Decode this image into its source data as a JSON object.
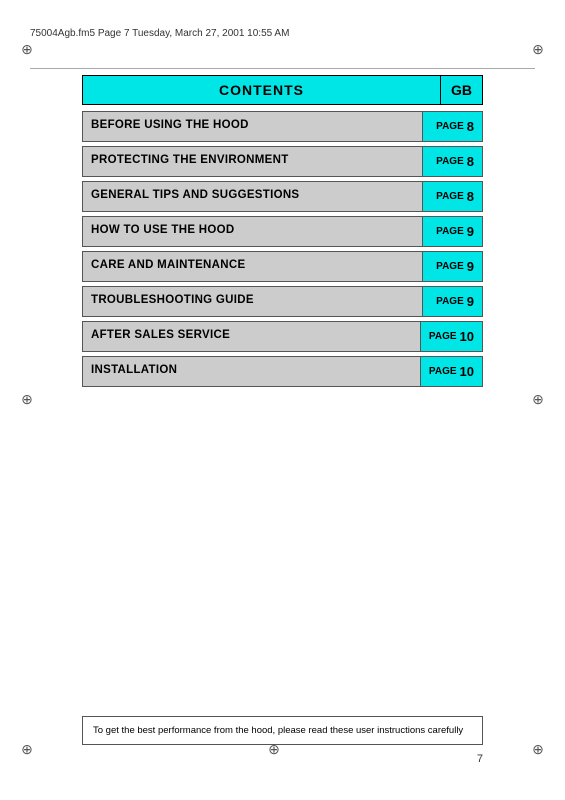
{
  "header": {
    "filename": "75004Agb.fm5  Page 7  Tuesday, March 27, 2001  10:55 AM"
  },
  "contents": {
    "title": "CONTENTS",
    "gb_label": "GB"
  },
  "toc_items": [
    {
      "title": "BEFORE USING THE HOOD",
      "page_label": "PAGE",
      "page_num": "8"
    },
    {
      "title": "PROTECTING THE ENVIRONMENT",
      "page_label": "PAGE",
      "page_num": "8"
    },
    {
      "title": "GENERAL TIPS AND SUGGESTIONS",
      "page_label": "PAGE",
      "page_num": "8"
    },
    {
      "title": "HOW TO USE THE HOOD",
      "page_label": "PAGE",
      "page_num": "9"
    },
    {
      "title": "CARE AND MAINTENANCE",
      "page_label": "PAGE",
      "page_num": "9"
    },
    {
      "title": "TROUBLESHOOTING GUIDE",
      "page_label": "PAGE",
      "page_num": "9"
    },
    {
      "title": "AFTER SALES SERVICE",
      "page_label": "PAGE",
      "page_num": "10"
    },
    {
      "title": "INSTALLATION",
      "page_label": "PAGE",
      "page_num": "10"
    }
  ],
  "footer_note": "To get the best performance from the hood, please read these user instructions carefully",
  "page_number": "7"
}
